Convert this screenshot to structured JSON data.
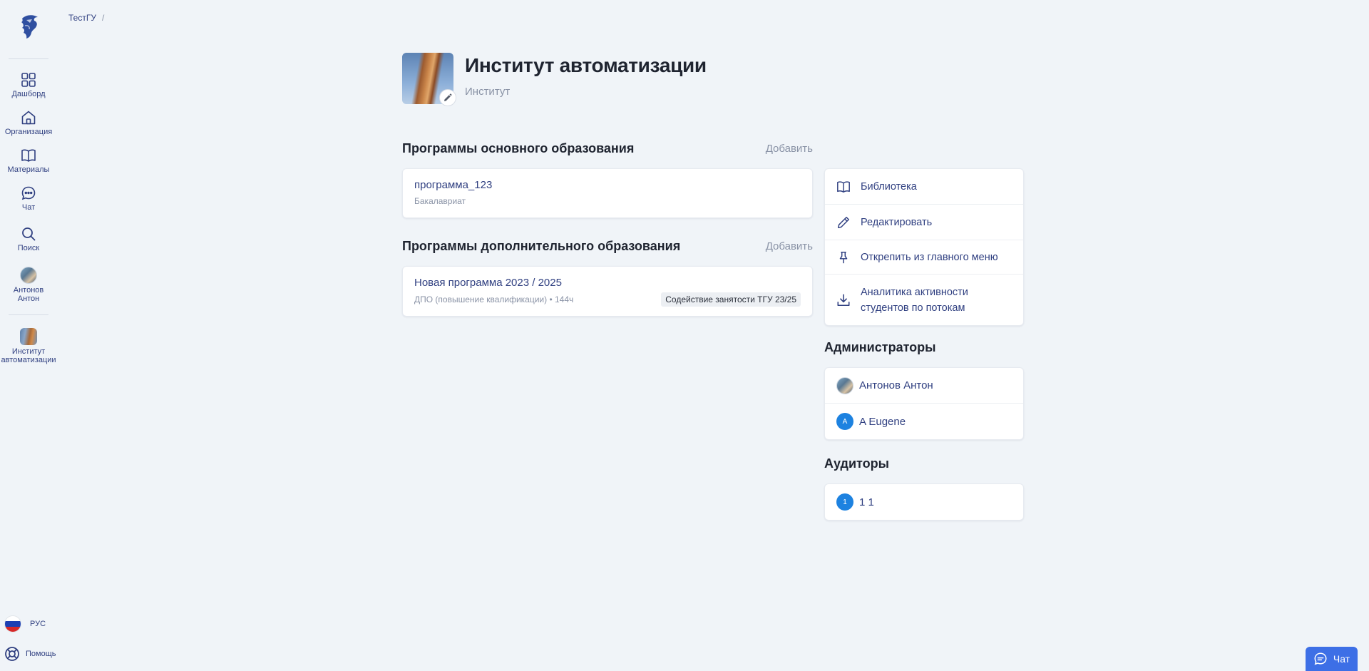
{
  "sidebar": {
    "nav": [
      {
        "label": "Дашборд",
        "icon": "grid-icon"
      },
      {
        "label": "Организация",
        "icon": "house-icon"
      },
      {
        "label": "Материалы",
        "icon": "book-icon"
      },
      {
        "label": "Чат",
        "icon": "chat-bubble-icon"
      },
      {
        "label": "Поиск",
        "icon": "search-icon"
      },
      {
        "label": "Антонов Антон",
        "icon": "avatar"
      }
    ],
    "pinned": [
      {
        "label": "Институт автоматизации",
        "icon": "institute-thumbnail"
      }
    ],
    "language": "РУС",
    "help": "Помощь"
  },
  "breadcrumb": {
    "items": [
      "ТестГУ"
    ],
    "separator": "/"
  },
  "header": {
    "title": "Институт автоматизации",
    "subtitle": "Институт"
  },
  "main_programs": {
    "title": "Программы основного образования",
    "add_label": "Добавить",
    "items": [
      {
        "name": "программа_123",
        "level": "Бакалавриат"
      }
    ]
  },
  "extra_programs": {
    "title": "Программы дополнительного образования",
    "add_label": "Добавить",
    "items": [
      {
        "name": "Новая программа 2023 / 2025",
        "meta": "ДПО (повышение квалификации) • 144ч",
        "tag": "Содействие занятости ТГУ 23/25"
      }
    ]
  },
  "actions": [
    {
      "label": "Библиотека",
      "icon": "book-icon"
    },
    {
      "label": "Редактировать",
      "icon": "pencil-icon"
    },
    {
      "label": "Открепить из главного меню",
      "icon": "pin-icon"
    },
    {
      "label": "Аналитика активности студентов по потокам",
      "icon": "download-icon"
    }
  ],
  "administrators": {
    "title": "Администраторы",
    "people": [
      {
        "name": "Антонов Антон",
        "avatar": "photo"
      },
      {
        "name": "A Eugene",
        "initial": "A"
      }
    ]
  },
  "auditors": {
    "title": "Аудиторы",
    "people": [
      {
        "name": "1 1",
        "initial": "1"
      }
    ]
  },
  "chat_button": {
    "label": "Чат",
    "icon": "chat-bubble-icon"
  },
  "colors": {
    "background": "#f0f4f8",
    "accent_text": "#2f3f80",
    "muted_text": "#8a93a6",
    "initial_badge": "#1d82e0",
    "chat_button": "#3d6fe6"
  }
}
